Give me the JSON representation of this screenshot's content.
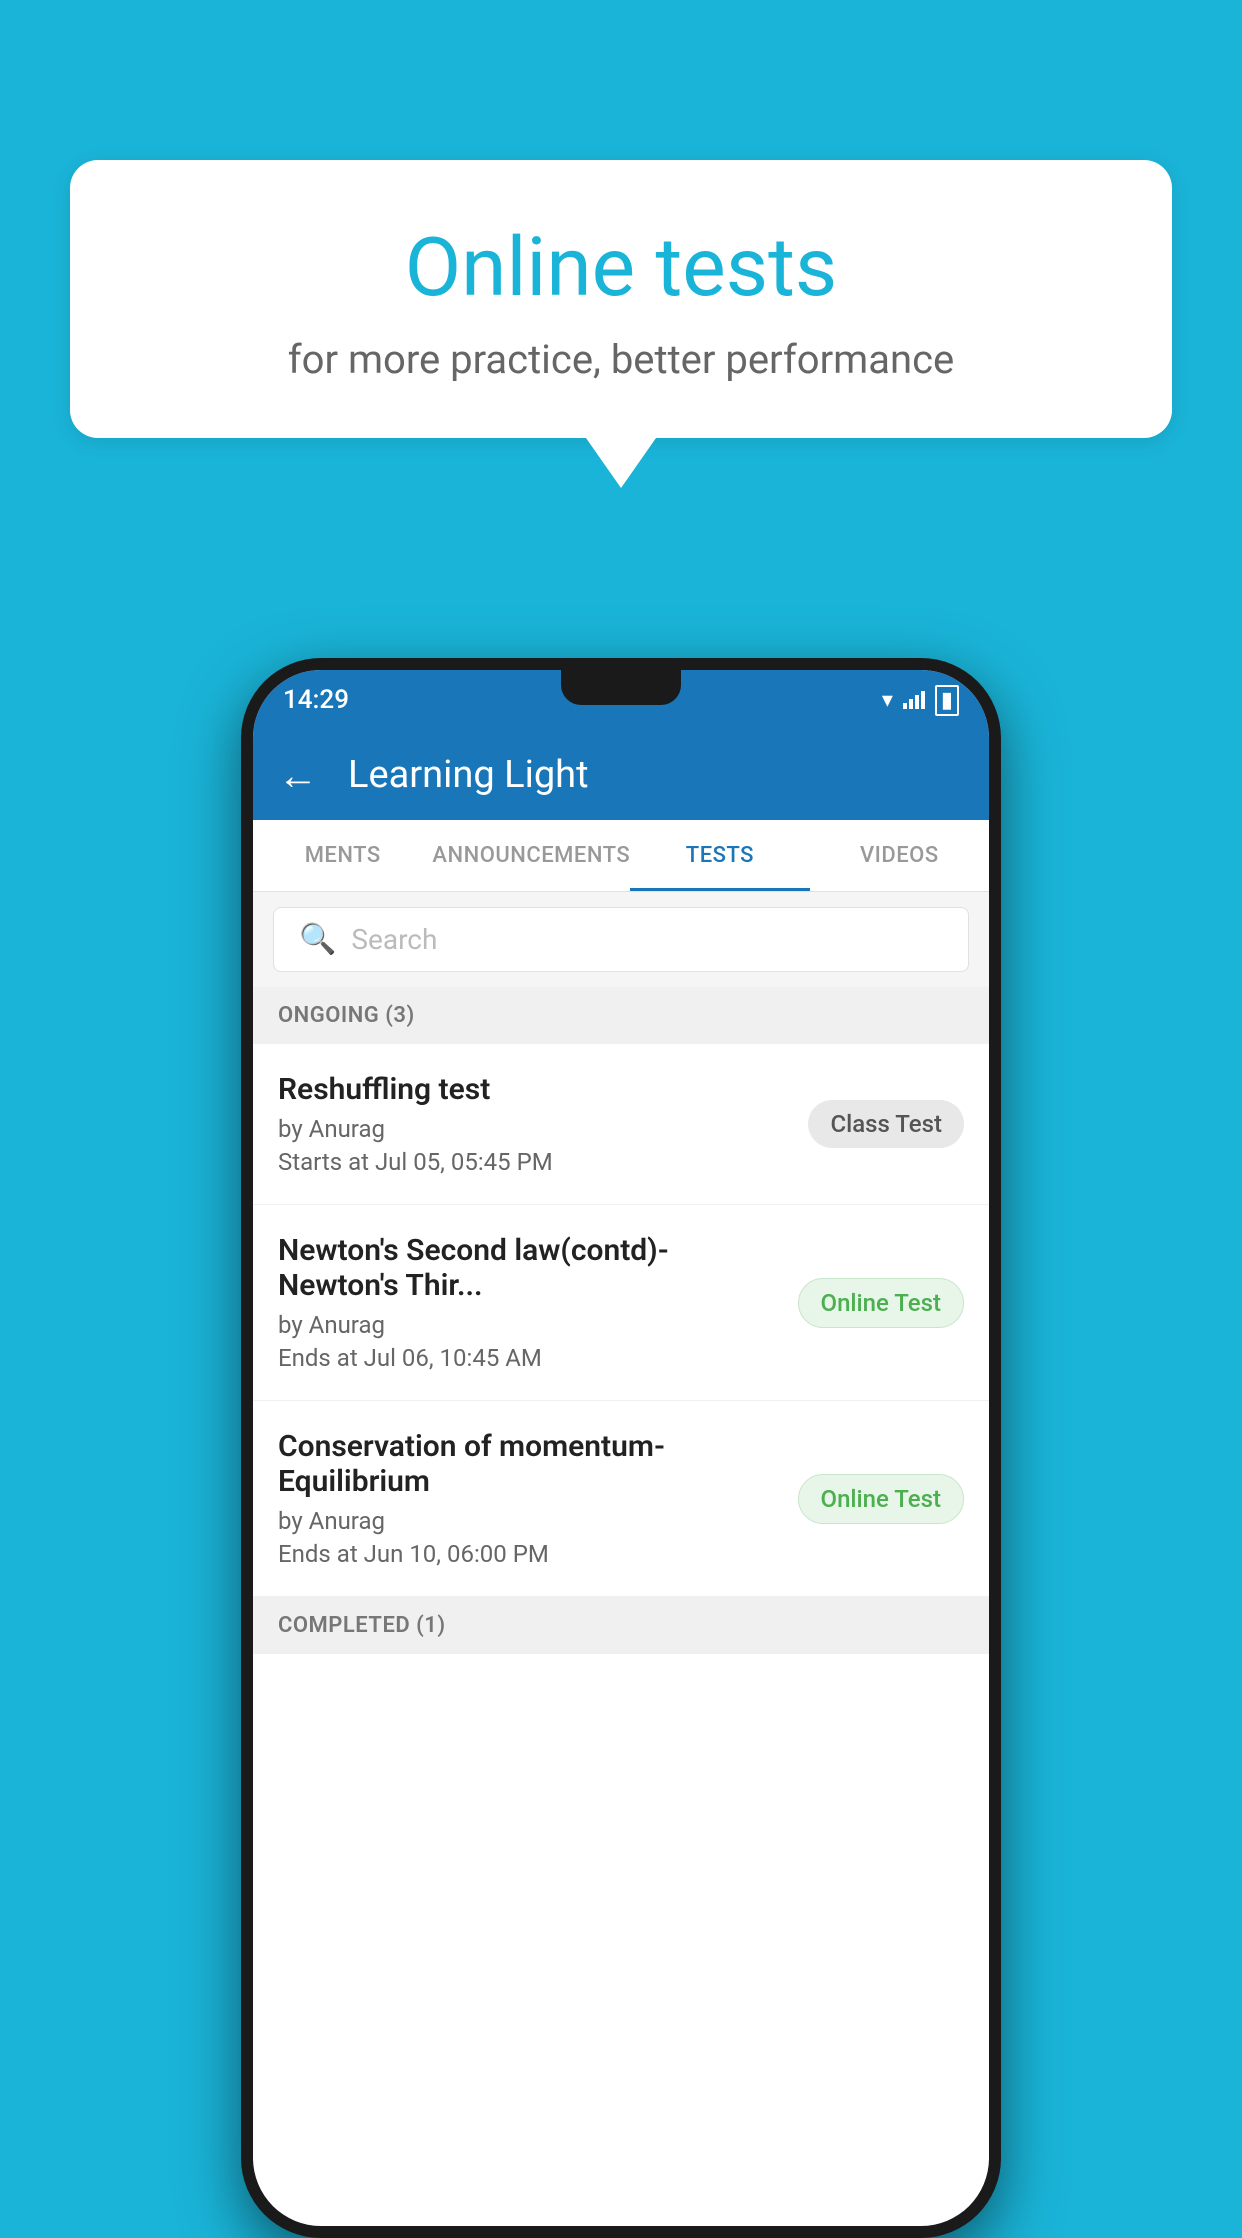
{
  "background_color": "#1ab4d8",
  "speech_bubble": {
    "title": "Online tests",
    "subtitle": "for more practice, better performance"
  },
  "phone": {
    "status_bar": {
      "time": "14:29",
      "icons": [
        "wifi",
        "signal",
        "battery"
      ]
    },
    "app_bar": {
      "title": "Learning Light",
      "back_label": "←"
    },
    "tabs": [
      {
        "label": "MENTS",
        "active": false
      },
      {
        "label": "ANNOUNCEMENTS",
        "active": false
      },
      {
        "label": "TESTS",
        "active": true
      },
      {
        "label": "VIDEOS",
        "active": false
      }
    ],
    "search": {
      "placeholder": "Search"
    },
    "ongoing_section": {
      "label": "ONGOING (3)"
    },
    "tests": [
      {
        "name": "Reshuffling test",
        "author": "by Anurag",
        "time_label": "Starts at",
        "time": "Jul 05, 05:45 PM",
        "badge": "Class Test",
        "badge_type": "class"
      },
      {
        "name": "Newton's Second law(contd)-Newton's Thir...",
        "author": "by Anurag",
        "time_label": "Ends at",
        "time": "Jul 06, 10:45 AM",
        "badge": "Online Test",
        "badge_type": "online"
      },
      {
        "name": "Conservation of momentum-Equilibrium",
        "author": "by Anurag",
        "time_label": "Ends at",
        "time": "Jun 10, 06:00 PM",
        "badge": "Online Test",
        "badge_type": "online"
      }
    ],
    "completed_section": {
      "label": "COMPLETED (1)"
    }
  }
}
